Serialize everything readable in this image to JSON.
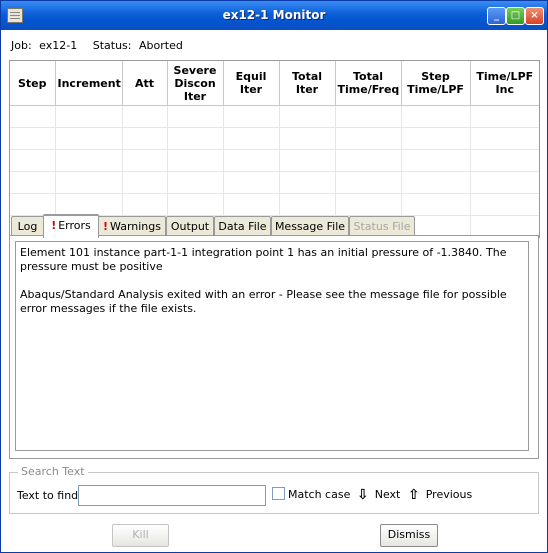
{
  "window": {
    "title": "ex12-1 Monitor"
  },
  "job": {
    "job_label": "Job:",
    "job_value": "ex12-1",
    "status_label": "Status:",
    "status_value": "Aborted"
  },
  "table": {
    "columns": [
      "Step",
      "Increment",
      "Att",
      "Severe\nDiscon\nIter",
      "Equil\nIter",
      "Total\nIter",
      "Total\nTime/Freq",
      "Step\nTime/LPF",
      "Time/LPF\nInc"
    ],
    "rows": []
  },
  "tabs": [
    {
      "label": "Log"
    },
    {
      "label": "Errors",
      "alert": "!"
    },
    {
      "label": "Warnings",
      "alert": "!"
    },
    {
      "label": "Output"
    },
    {
      "label": "Data File"
    },
    {
      "label": "Message File"
    },
    {
      "label": "Status File"
    }
  ],
  "active_tab": "Errors",
  "errors_text": [
    "Element 101 instance part-1-1 integration point 1 has an initial pressure of -1.3840. The pressure must be positive",
    "Abaqus/Standard Analysis exited with an error - Please see the  message file for possible error messages if the file exists."
  ],
  "search": {
    "legend": "Search Text",
    "find_label": "Text to find:",
    "find_value": "",
    "match_case_label": "Match case",
    "next_label": "Next",
    "previous_label": "Previous"
  },
  "buttons": {
    "kill": "Kill",
    "dismiss": "Dismiss"
  },
  "icons": {
    "next": "arrow-down-icon",
    "previous": "arrow-up-icon",
    "alert_color": "#dd0000",
    "active_tab_accent": "#f3a42b"
  }
}
